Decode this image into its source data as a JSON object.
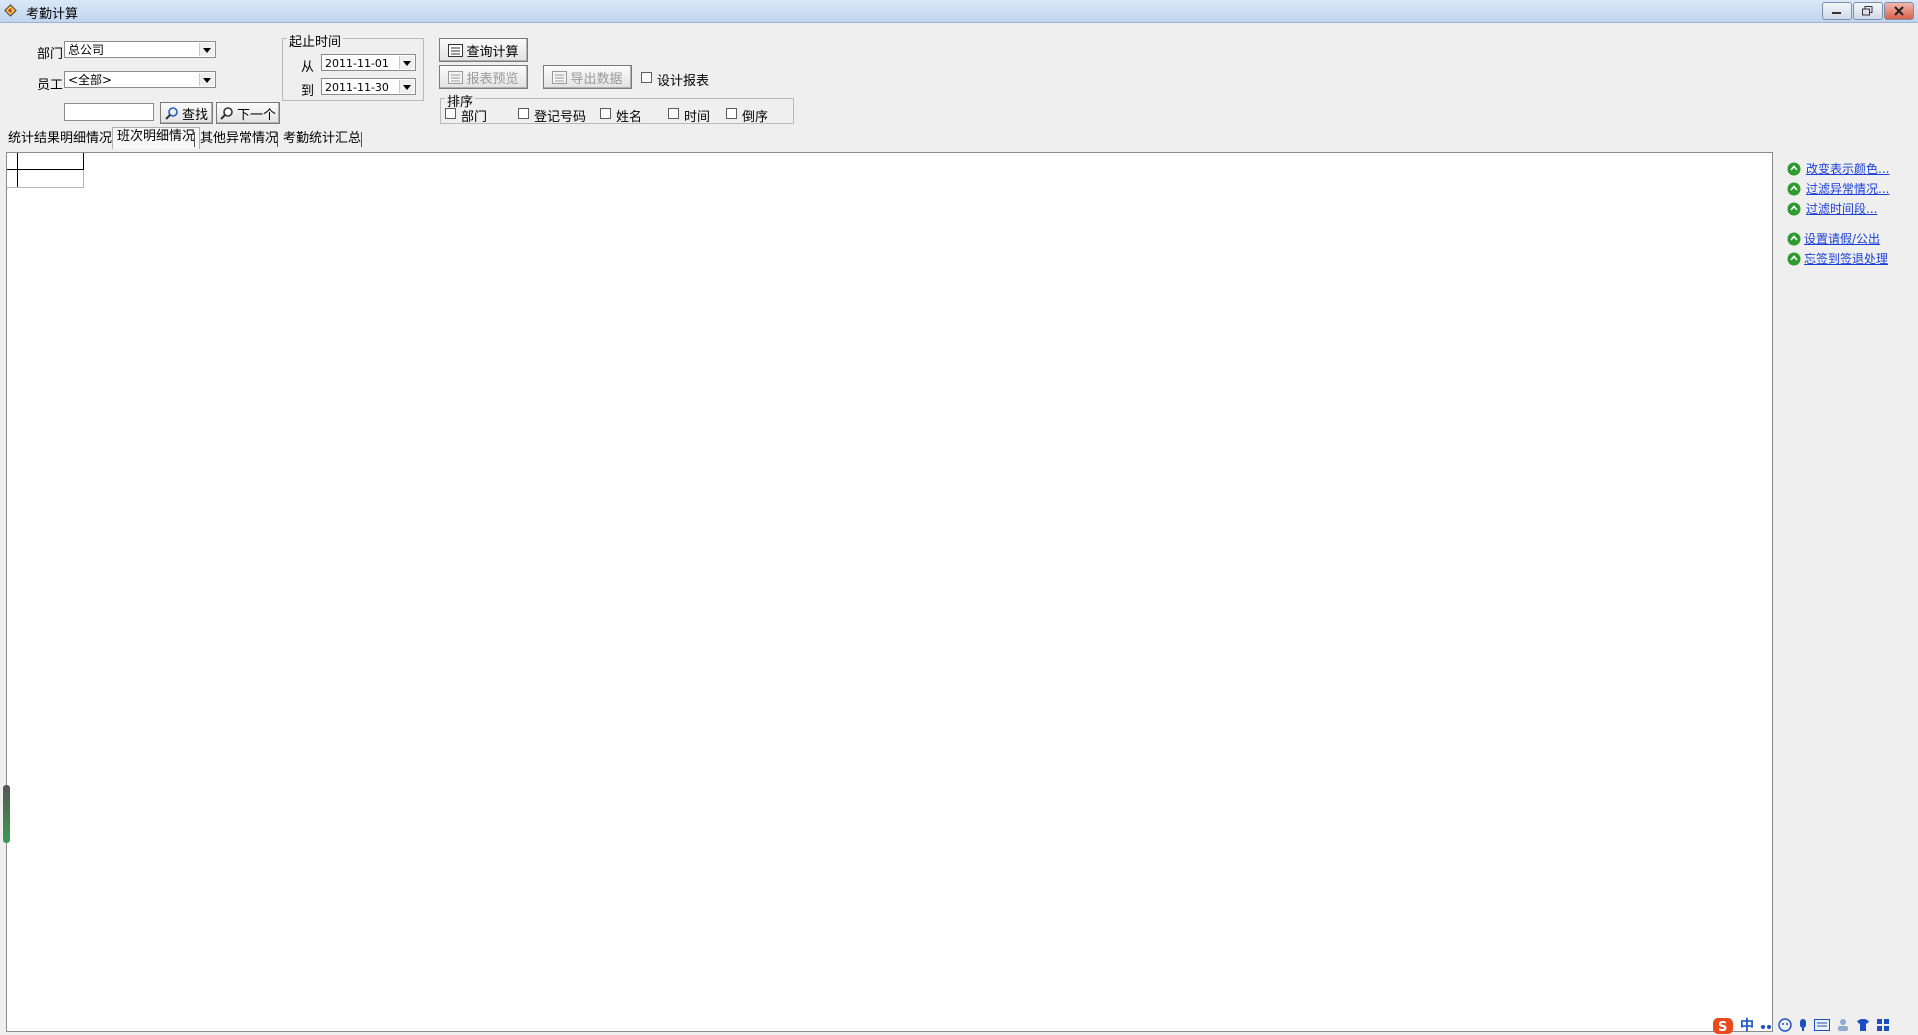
{
  "window": {
    "title": "考勤计算",
    "controls": [
      "minimize",
      "restore",
      "close"
    ]
  },
  "filters": {
    "department_label": "部门",
    "department_value": "总公司",
    "employee_label": "员工",
    "employee_value": "<全部>",
    "search_value": "",
    "find_label": "查找",
    "next_label": "下一个"
  },
  "date_range": {
    "legend": "起止时间",
    "from_label": "从",
    "from_value": "2011-11-01",
    "to_label": "到",
    "to_value": "2011-11-30"
  },
  "actions": {
    "query_label": "查询计算",
    "preview_label": "报表预览",
    "export_label": "导出数据",
    "design_report_label": "设计报表"
  },
  "sort": {
    "legend": "排序",
    "options": [
      "部门",
      "登记号码",
      "姓名",
      "时间",
      "倒序"
    ]
  },
  "tabs": [
    "统计结果明细情况",
    "班次明细情况",
    "其他异常情况",
    "考勤统计汇总"
  ],
  "active_tab": "班次明细情况",
  "side_links": [
    "改变表示颜色...",
    "过滤异常情况...",
    "过滤时间段...",
    "设置请假/公出",
    "忘签到签退处理"
  ],
  "taskbar": {
    "ime_label": "中"
  },
  "colors": {
    "link": "#1a3fd6",
    "icon_green": "#2e9b2e",
    "titlebar": "#c2d5ee"
  }
}
